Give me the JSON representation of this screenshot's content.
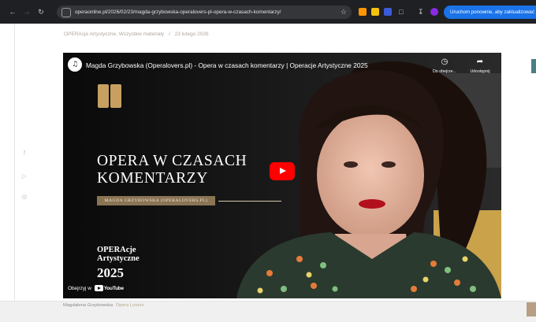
{
  "browser": {
    "url": "operaonline.pl/2026/02/23/magda-grzybowska-operalovers-pl-opera-w-czasach-komentarzy/",
    "restart_label": "Uruchom ponownie, aby zaktualizować",
    "ext_colors": [
      "#ff9500",
      "#f4c20d",
      "#3b5bdb",
      "#8a2be2"
    ]
  },
  "breadcrumb": {
    "category": "OPERAcje Artystyczne, Wszystkie materiały",
    "separator": "/",
    "date": "23 lutego 2026"
  },
  "video": {
    "title": "Magda Grzybowska (Operalovers.pl) - Opera w czasach komentarzy | Operacje Artystyczne 2025",
    "watch_later_label": "Do obejrze...",
    "share_label": "Udostępnij",
    "overlay_title_line1": "OPERA W CZASACH",
    "overlay_title_line2": "KOMENTARZY",
    "overlay_subtitle": "MAGDA GRZYBOWSKA (OPERALOVERS.PL)",
    "brand_line1": "OPERAcje",
    "brand_line2": "Artystyczne",
    "brand_line3": "2025",
    "watch_on_label": "Obejrzyj w",
    "youtube_label": "YouTube"
  },
  "caption": {
    "author": "Magdalena Grzybowska",
    "link": "Opera Lovers"
  },
  "colors": {
    "accent_red": "#ff0000",
    "brand_blue": "#1a73e8",
    "gold": "#8a7454"
  }
}
